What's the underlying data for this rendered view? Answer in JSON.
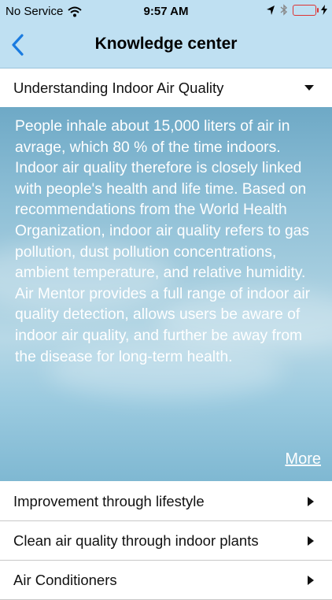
{
  "status_bar": {
    "carrier": "No Service",
    "time": "9:57 AM"
  },
  "nav": {
    "title": "Knowledge center"
  },
  "sections": [
    {
      "label": "Understanding Indoor Air Quality",
      "expanded": true
    },
    {
      "label": "Improvement through lifestyle",
      "expanded": false
    },
    {
      "label": "Clean air quality through indoor plants",
      "expanded": false
    },
    {
      "label": "Air Conditioners",
      "expanded": false
    }
  ],
  "content": {
    "text": "People inhale about 15,000 liters of air in avrage, which 80 % of the time indoors. Indoor air quality therefore is closely linked with people's health and life time. Based on recommendations from the World Health Organization, indoor air quality refers to gas pollution, dust pollution concentrations, ambient temperature, and relative humidity. Air Mentor provides a full range of indoor air quality detection, allows users be aware of indoor air quality, and further be away from the disease for long-term health.",
    "more_label": "More"
  },
  "colors": {
    "bar_bg": "#bfe0f2",
    "accent": "#1a7be0",
    "battery": "#dd3333"
  }
}
